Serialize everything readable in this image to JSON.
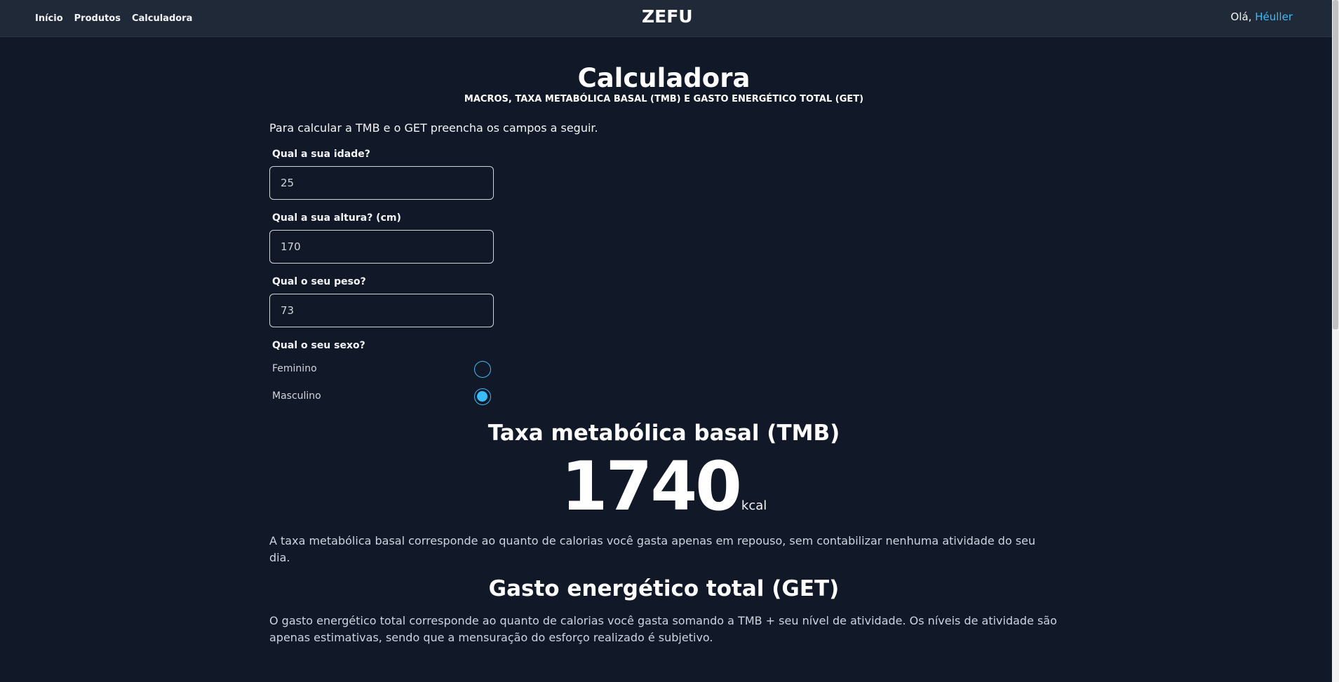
{
  "nav": {
    "links": [
      "Início",
      "Produtos",
      "Calculadora"
    ],
    "logo": "ZEFU",
    "greeting_prefix": "Olá,",
    "user_name": "Héuller"
  },
  "page": {
    "title": "Calculadora",
    "subtitle": "MACROS, TAXA METABÓLICA BASAL (TMB) E GASTO ENERGÉTICO TOTAL (GET)",
    "intro": "Para calcular a TMB e o GET preencha os campos a seguir."
  },
  "form": {
    "age": {
      "label": "Qual a sua idade?",
      "value": "25"
    },
    "height": {
      "label": "Qual a sua altura? (cm)",
      "value": "170"
    },
    "weight": {
      "label": "Qual o seu peso?",
      "value": "73"
    },
    "sex": {
      "label": "Qual o seu sexo?",
      "options": [
        "Feminino",
        "Masculino"
      ],
      "selected": "Masculino"
    }
  },
  "tmb": {
    "title": "Taxa metabólica basal (TMB)",
    "value": "1740",
    "unit": "kcal",
    "description": "A taxa metabólica basal corresponde ao quanto de calorias você gasta apenas em repouso, sem contabilizar nenhuma atividade do seu dia."
  },
  "get": {
    "title": "Gasto energético total (GET)",
    "description": "O gasto energético total corresponde ao quanto de calorias você gasta somando a TMB + seu nível de atividade. Os níveis de atividade são apenas estimativas, sendo que a mensuração do esforço realizado é subjetivo."
  },
  "colors": {
    "background": "#111827",
    "navbar": "#1f2937",
    "accent": "#38bdf8"
  }
}
